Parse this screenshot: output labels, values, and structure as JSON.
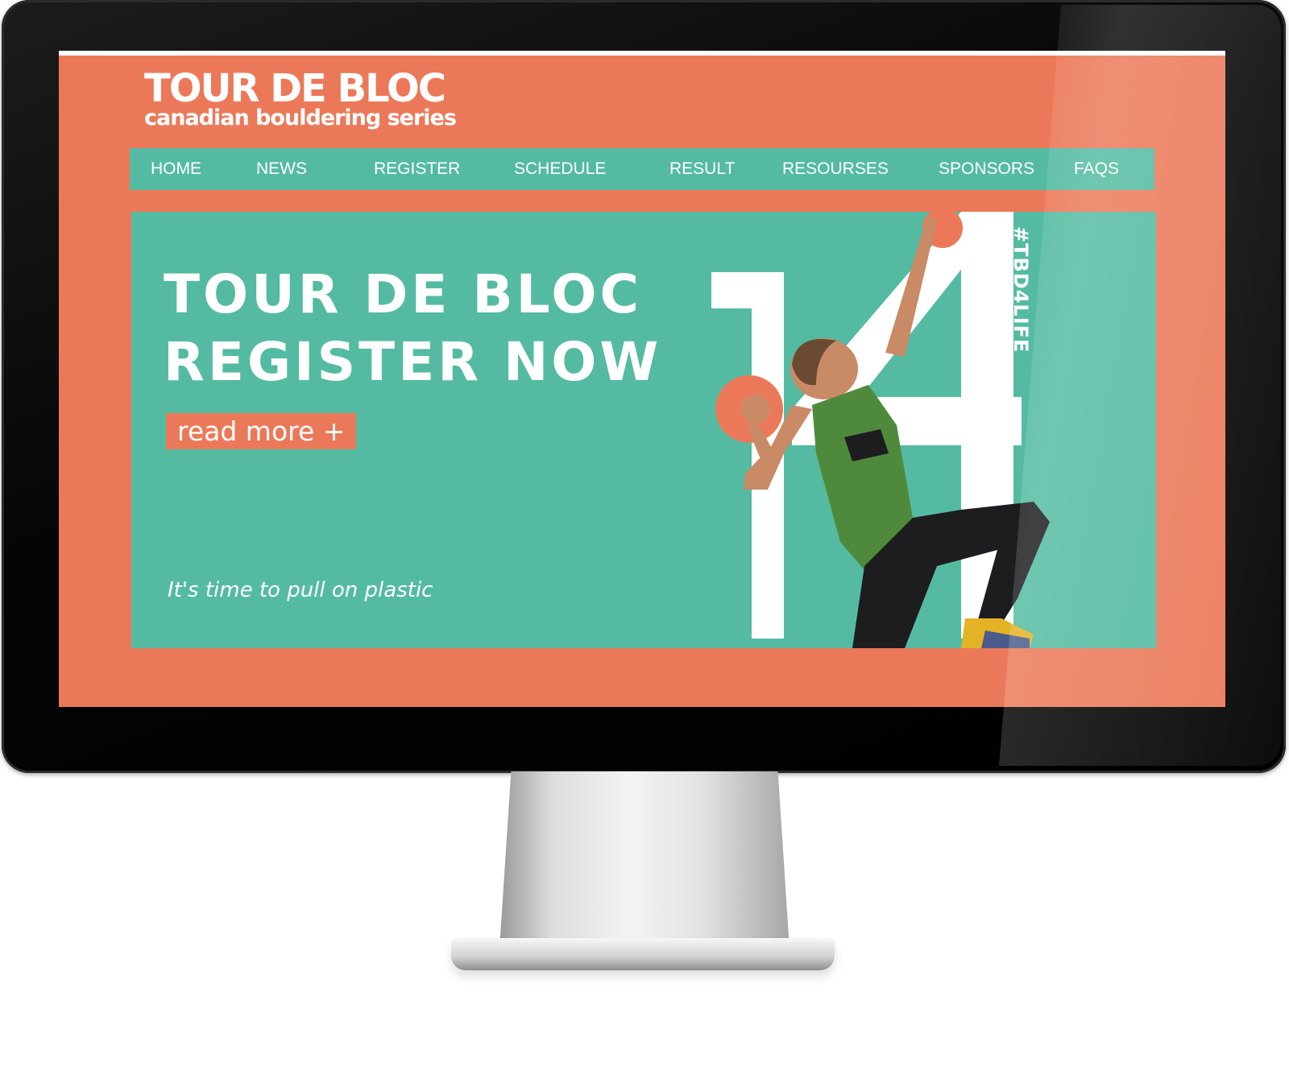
{
  "logo": {
    "title": "TOUR DE BLOC",
    "subtitle": "canadian bouldering series"
  },
  "nav": {
    "items": [
      {
        "label": "HOME"
      },
      {
        "label": "NEWS"
      },
      {
        "label": "REGISTER"
      },
      {
        "label": "SCHEDULE"
      },
      {
        "label": "RESULT"
      },
      {
        "label": "RESOURSES"
      },
      {
        "label": "SPONSORS"
      },
      {
        "label": "FAQS"
      }
    ]
  },
  "hero": {
    "line1": "TOUR DE BLOC",
    "line2": "REGISTER NOW",
    "read_more": "read more +",
    "tagline": "It's time to pull on plastic",
    "hashtag": "#TBD4LIFE",
    "big_number": "14"
  },
  "colors": {
    "coral": "#eb7959",
    "teal": "#54bba2",
    "white": "#ffffff",
    "shirt": "#4f8a3c",
    "pants": "#1d1d20",
    "skin": "#c98a66"
  }
}
